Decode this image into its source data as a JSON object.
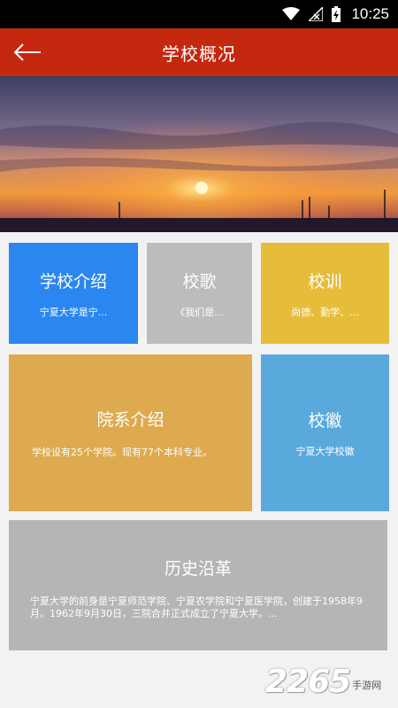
{
  "status": {
    "time": "10:25"
  },
  "header": {
    "title": "学校概况"
  },
  "tiles": {
    "intro": {
      "title": "学校介绍",
      "subtitle": "宁夏大学是宁..."
    },
    "song": {
      "title": "校歌",
      "subtitle": "《我们是..."
    },
    "motto": {
      "title": "校训",
      "subtitle": "尚德、勤学、..."
    },
    "departments": {
      "title": "院系介绍",
      "subtitle": "学校设有25个学院。现有77个本科专业。"
    },
    "badge": {
      "title": "校徽",
      "subtitle": "宁夏大学校徽"
    },
    "history": {
      "title": "历史沿革",
      "subtitle": "宁夏大学的前身是宁夏师范学院、宁夏农学院和宁夏医学院，创建于1958年9月。1962年9月30日，三院合并正式成立了宁夏大学。..."
    }
  },
  "watermark": {
    "number": "2265",
    "text": "手游网"
  },
  "colors": {
    "appbar": "#c4280f",
    "intro": "#2b86ef",
    "song": "#bcbcbc",
    "motto": "#e6bd3b",
    "departments": "#deaa4f",
    "badge": "#5aa9dc",
    "history": "#b5b5b5"
  }
}
